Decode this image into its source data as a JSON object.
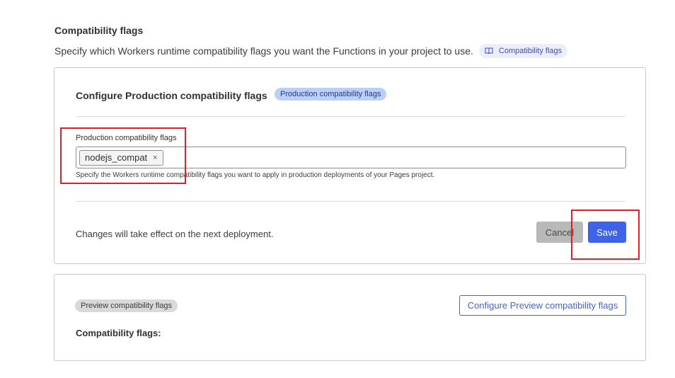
{
  "section": {
    "title": "Compatibility flags",
    "description": "Specify which Workers runtime compatibility flags you want the Functions in your project to use.",
    "doc_link": {
      "label": "Compatibility flags",
      "icon": "book-icon"
    }
  },
  "production": {
    "title": "Configure Production compatibility flags",
    "badge": "Production compatibility flags",
    "field_label": "Production compatibility flags",
    "tags": [
      "nodejs_compat"
    ],
    "tag_remove_symbol": "×",
    "help_text": "Specify the Workers runtime compatibility flags you want to apply in production deployments of your Pages project.",
    "footer_note": "Changes will take effect on the next deployment.",
    "cancel_label": "Cancel",
    "save_label": "Save"
  },
  "preview": {
    "badge": "Preview compatibility flags",
    "configure_button_label": "Configure Preview compatibility flags",
    "flags_label": "Compatibility flags:"
  },
  "colors": {
    "primary": "#3f63e8",
    "highlight": "#e0202a",
    "badge_blue_bg": "#bcd0f7",
    "badge_grey_bg": "#d9d9d9"
  }
}
